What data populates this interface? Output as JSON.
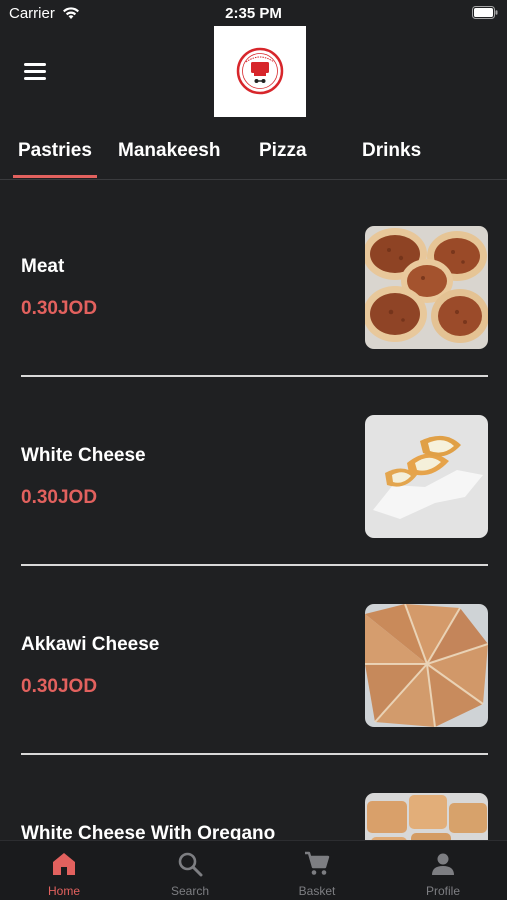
{
  "status_bar": {
    "carrier": "Carrier",
    "time": "2:35 PM"
  },
  "header": {
    "logo_icon": "restaurant-logo"
  },
  "tabs": [
    {
      "label": "Pastries",
      "active": true
    },
    {
      "label": "Manakeesh"
    },
    {
      "label": "Pizza"
    },
    {
      "label": "Drinks"
    }
  ],
  "items": [
    {
      "name": "Meat",
      "price": "0.30JOD",
      "image": "meat-pastry-photo"
    },
    {
      "name": "White Cheese",
      "price": "0.30JOD",
      "image": "white-cheese-pastry-photo"
    },
    {
      "name": "Akkawi Cheese",
      "price": "0.30JOD",
      "image": "akkawi-cheese-pastry-photo"
    },
    {
      "name": "White Cheese With Oregano",
      "image": "oregano-pastry-photo"
    }
  ],
  "bottom_nav": [
    {
      "label": "Home",
      "icon": "home-icon",
      "active": true
    },
    {
      "label": "Search",
      "icon": "search-icon"
    },
    {
      "label": "Basket",
      "icon": "cart-icon"
    },
    {
      "label": "Profile",
      "icon": "profile-icon"
    }
  ],
  "colors": {
    "accent": "#e2615e",
    "background": "#1f2022",
    "inactive": "#7d7e82"
  }
}
